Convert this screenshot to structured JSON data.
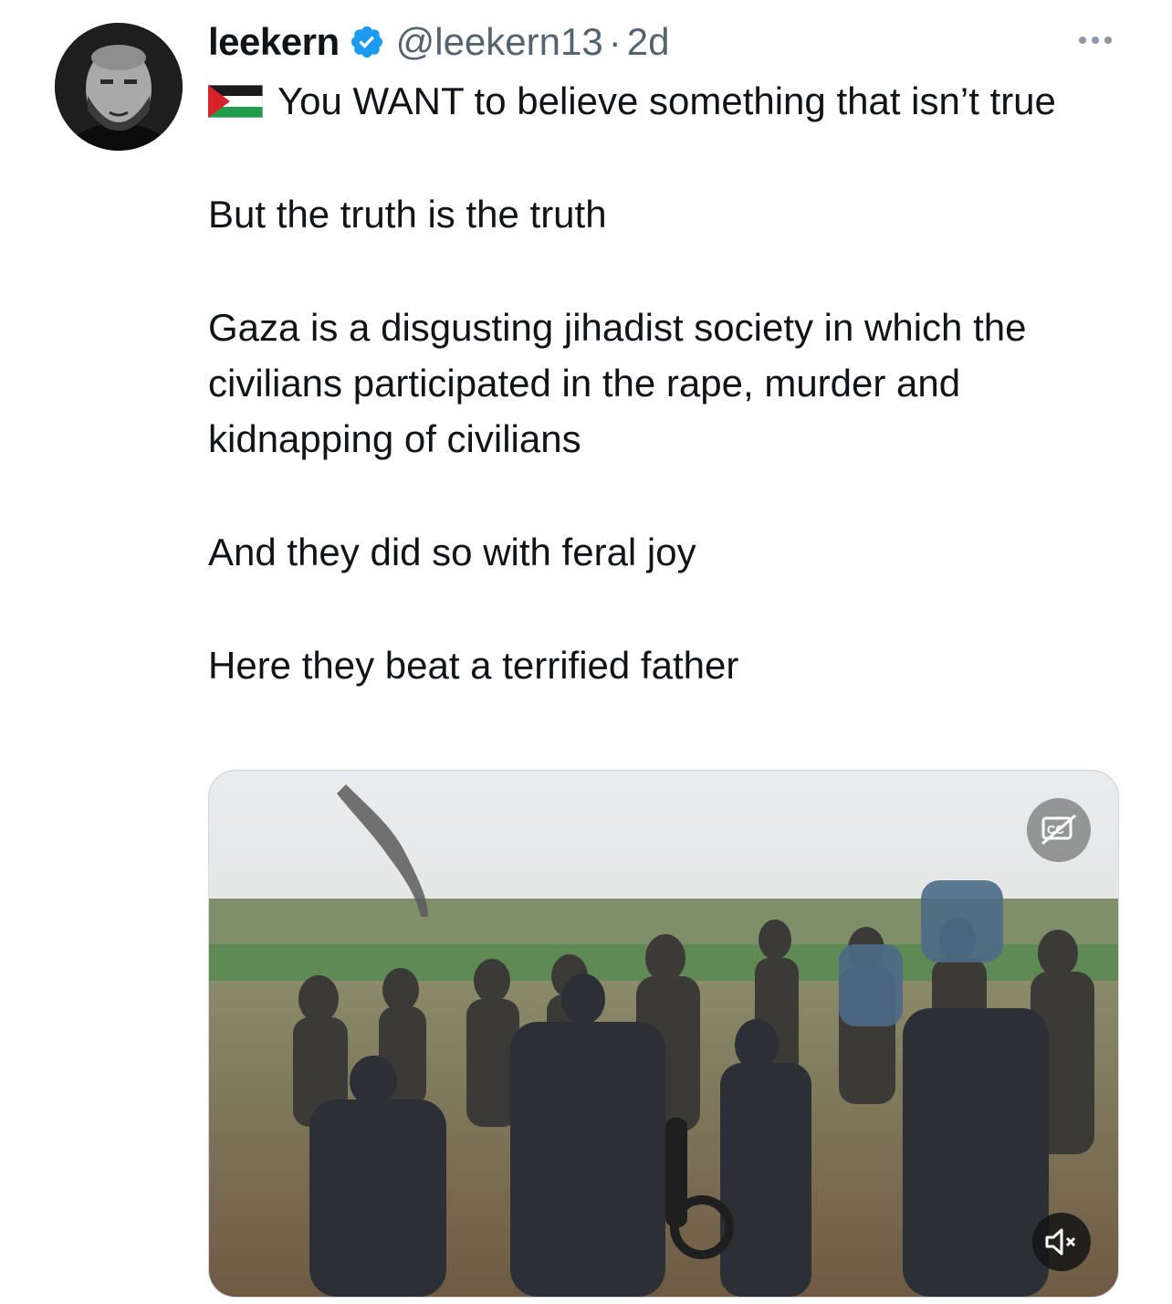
{
  "tweet": {
    "author": {
      "display_name": "leekern",
      "handle": "@leekern13",
      "verified": true,
      "avatar_icon": "avatar-photo"
    },
    "separator": "·",
    "timestamp": "2d",
    "first_line_emoji": "palestine-flag-icon",
    "paragraphs": [
      "You WANT to believe something that isn’t true",
      "But the truth is the truth",
      "Gaza is a disgusting jihadist society in which the civilians participated in the rape, murder and kidnapping of civilians",
      "And they did so with feral joy",
      "Here they beat a terrified father"
    ],
    "media": {
      "type": "video",
      "captions_icon": "closed-captions-icon",
      "mute_icon": "speaker-muted-icon"
    }
  },
  "colors": {
    "text_primary": "#0f1419",
    "text_secondary": "#536471",
    "verified_blue": "#1d9bf0"
  }
}
